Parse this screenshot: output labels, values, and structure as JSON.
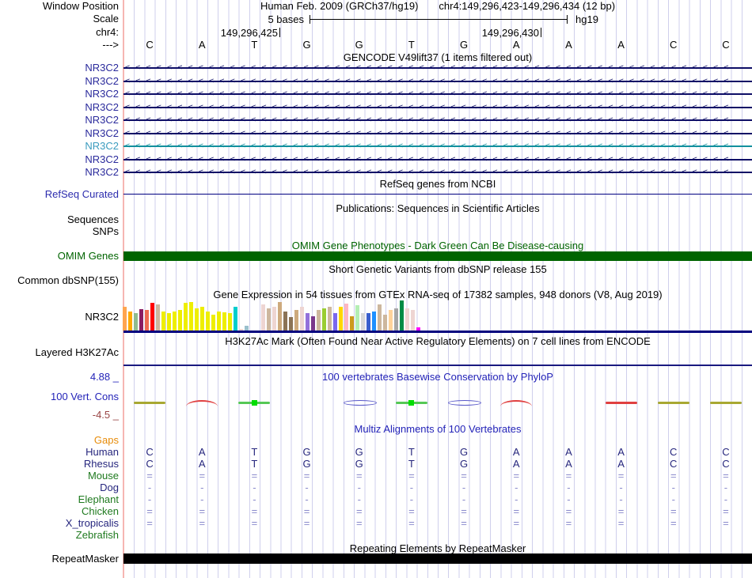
{
  "colors": {
    "grid": "#cfcfec",
    "edge_highlight": "#f6b6b2",
    "gene_navy": "#0d0d66",
    "gene_teal": "#12909e",
    "blue_text": "#2323b8",
    "green_text": "#1f7a1f",
    "omim_green": "#006400",
    "maroon_text": "#994444",
    "align_letter": "#26267e",
    "align_symbol": "#8a8acc",
    "baseline_navy": "#00007e"
  },
  "header": {
    "window_position_label": "Window Position",
    "assembly_title": "Human Feb. 2009 (GRCh37/hg19)",
    "position_title": "chr4:149,296,423-149,296,434 (12 bp)",
    "scale_label": "Scale",
    "scale_text": "5 bases",
    "scale_genome": "hg19",
    "chrom_label": "chr4:",
    "coord_left": "149,296,425",
    "coord_right": "149,296,430",
    "strand_label": "--->"
  },
  "sequence": {
    "bases": [
      "C",
      "A",
      "T",
      "G",
      "G",
      "T",
      "G",
      "A",
      "A",
      "A",
      "C",
      "C"
    ]
  },
  "gencode": {
    "title": "GENCODE V49lift37 (1 items filtered out)",
    "arrow_char": "<",
    "genes": [
      {
        "label": "NR3C2",
        "line_color": "#0d0d66",
        "label_color": "#2a2a9c"
      },
      {
        "label": "NR3C2",
        "line_color": "#0d0d66",
        "label_color": "#2a2a9c"
      },
      {
        "label": "NR3C2",
        "line_color": "#0d0d66",
        "label_color": "#2a2a9c"
      },
      {
        "label": "NR3C2",
        "line_color": "#0d0d66",
        "label_color": "#2a2a9c"
      },
      {
        "label": "NR3C2",
        "line_color": "#0d0d66",
        "label_color": "#2a2a9c"
      },
      {
        "label": "NR3C2",
        "line_color": "#0d0d66",
        "label_color": "#2a2a9c"
      },
      {
        "label": "NR3C2",
        "line_color": "#12909e",
        "label_color": "#3a9bbe"
      },
      {
        "label": "NR3C2",
        "line_color": "#0d0d66",
        "label_color": "#2a2a9c"
      },
      {
        "label": "NR3C2",
        "line_color": "#0d0d66",
        "label_color": "#2a2a9c"
      }
    ]
  },
  "refseq": {
    "title": "RefSeq genes from NCBI",
    "label": "RefSeq Curated"
  },
  "publications": {
    "title": "Publications: Sequences in Scientific Articles",
    "row1": "Sequences",
    "row2": "SNPs"
  },
  "omim": {
    "title": "OMIM Gene Phenotypes - Dark Green Can Be Disease-causing",
    "label": "OMIM Genes"
  },
  "dbsnp": {
    "title": "Short Genetic Variants from dbSNP release 155",
    "label": "Common dbSNP(155)"
  },
  "gtex": {
    "title": "Gene Expression in 54 tissues from GTEx RNA-seq of 17382 samples, 948 donors (V8, Aug 2019)",
    "label": "NR3C2"
  },
  "h3k27ac": {
    "title": "H3K27Ac Mark (Often Found Near Active Regulatory Elements) on 7 cell lines from ENCODE",
    "label": "Layered H3K27Ac"
  },
  "phylop": {
    "title": "100 vertebrates Basewise Conservation by PhyloP",
    "label": "100 Vert. Cons",
    "max_label": "4.88 _",
    "min_label": "-4.5 _",
    "marks": [
      {
        "shape": "dash",
        "color": "#a8a832"
      },
      {
        "shape": "arc",
        "color": "#e04040"
      },
      {
        "shape": "dash_square",
        "color": "#55c855",
        "square_color": "#00dd00"
      },
      {
        "shape": "none",
        "color": ""
      },
      {
        "shape": "lens",
        "color": "#5858c8"
      },
      {
        "shape": "dash_square",
        "color": "#55c855",
        "square_color": "#00dd00"
      },
      {
        "shape": "lens",
        "color": "#5858c8"
      },
      {
        "shape": "arc",
        "color": "#e04040"
      },
      {
        "shape": "none",
        "color": ""
      },
      {
        "shape": "dash",
        "color": "#e04040"
      },
      {
        "shape": "dash",
        "color": "#a8a832"
      },
      {
        "shape": "dash",
        "color": "#a8a832"
      }
    ]
  },
  "multiz": {
    "title": "Multiz Alignments of 100 Vertebrates",
    "rows": [
      {
        "label": "Gaps",
        "label_color": "#e78c09",
        "cells": null,
        "cell_color": null
      },
      {
        "label": "Human",
        "label_color": "#26267e",
        "cell_color": "#26267e",
        "cells": [
          "C",
          "A",
          "T",
          "G",
          "G",
          "T",
          "G",
          "A",
          "A",
          "A",
          "C",
          "C"
        ]
      },
      {
        "label": "Rhesus",
        "label_color": "#26267e",
        "cell_color": "#26267e",
        "cells": [
          "C",
          "A",
          "T",
          "G",
          "G",
          "T",
          "G",
          "A",
          "A",
          "A",
          "C",
          "C"
        ]
      },
      {
        "label": "Mouse",
        "label_color": "#1f7a1f",
        "cell_color": "#8a8acc",
        "cells": [
          "=",
          "=",
          "=",
          "=",
          "=",
          "=",
          "=",
          "=",
          "=",
          "=",
          "=",
          "="
        ]
      },
      {
        "label": "Dog",
        "label_color": "#26267e",
        "cell_color": "#8a8acc",
        "cells": [
          "-",
          "-",
          "-",
          "-",
          "-",
          "-",
          "-",
          "-",
          "-",
          "-",
          "-",
          "-"
        ]
      },
      {
        "label": "Elephant",
        "label_color": "#1f7a1f",
        "cell_color": "#8a8acc",
        "cells": [
          "-",
          "-",
          "-",
          "-",
          "-",
          "-",
          "-",
          "-",
          "-",
          "-",
          "-",
          "-"
        ]
      },
      {
        "label": "Chicken",
        "label_color": "#1f7a1f",
        "cell_color": "#8a8acc",
        "cells": [
          "=",
          "=",
          "=",
          "=",
          "=",
          "=",
          "=",
          "=",
          "=",
          "=",
          "=",
          "="
        ]
      },
      {
        "label": "X_tropicalis",
        "label_color": "#26267e",
        "cell_color": "#8a8acc",
        "cells": [
          "=",
          "=",
          "=",
          "=",
          "=",
          "=",
          "=",
          "=",
          "=",
          "=",
          "=",
          "="
        ]
      },
      {
        "label": "Zebrafish",
        "label_color": "#1f7a1f",
        "cells": null,
        "cell_color": null
      }
    ]
  },
  "repeatmasker": {
    "title": "Repeating Elements by RepeatMasker",
    "label": "RepeatMasker"
  },
  "chart_data": {
    "type": "bar",
    "title": "Gene Expression in 54 tissues from GTEx RNA-seq of 17382 samples, 948 donors (V8, Aug 2019)",
    "xlabel": "",
    "ylabel": "",
    "ylim": [
      0,
      38
    ],
    "value_units": "relative bar height in px (no numeric axis shown in image)",
    "n_bars": 54,
    "values": [
      30,
      24,
      22,
      27,
      26,
      35,
      33,
      24,
      22,
      24,
      26,
      35,
      36,
      28,
      30,
      24,
      20,
      24,
      23,
      22,
      30,
      2,
      6,
      0,
      0,
      33,
      28,
      30,
      36,
      24,
      17,
      26,
      30,
      22,
      18,
      26,
      28,
      30,
      22,
      30,
      34,
      18,
      32,
      22,
      22,
      24,
      33,
      20,
      26,
      28,
      38,
      28,
      26,
      4
    ],
    "colors": [
      "#FFA54F",
      "#FFAA00",
      "#8FBC8F",
      "#8B1C62",
      "#EE6A50",
      "#FF0000",
      "#CDB79E",
      "#EEEE00",
      "#EEEE00",
      "#EEEE00",
      "#EEEE00",
      "#EEEE00",
      "#EEEE00",
      "#EEEE00",
      "#EEEE00",
      "#EEEE00",
      "#EEEE00",
      "#EEEE00",
      "#EEEE00",
      "#EEEE00",
      "#00CDCD",
      "#EED5D2",
      "#9AC0CD",
      "#EED5D2",
      "#EED5D2",
      "#EED5D2",
      "#CDB79E",
      "#EED5D2",
      "#CDAA7D",
      "#8B7355",
      "#8B7355",
      "#CDAA7D",
      "#EED5D2",
      "#9370DB",
      "#7A378B",
      "#CDB79E",
      "#9ACD32",
      "#CDB79E",
      "#7A67EE",
      "#FFD700",
      "#FFB6C1",
      "#CD9B1D",
      "#B4EEB4",
      "#D9D9D9",
      "#3A5FCD",
      "#1E90FF",
      "#CDB79E",
      "#CDB79E",
      "#FFD39B",
      "#A6A6A6",
      "#008B45",
      "#EED5D2",
      "#EED5D2",
      "#FF00FF"
    ]
  }
}
